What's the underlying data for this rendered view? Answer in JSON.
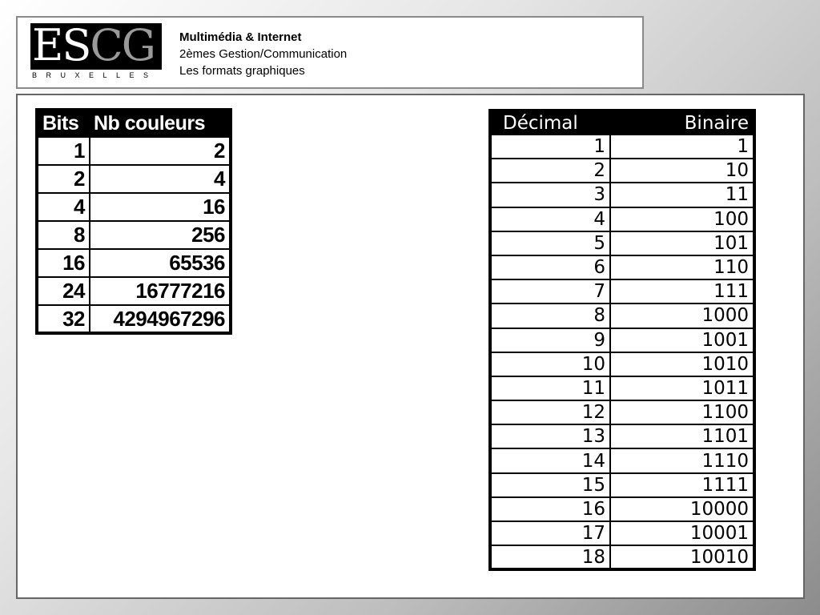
{
  "header": {
    "logo": {
      "letters": [
        "E",
        "S",
        "C",
        "G"
      ],
      "subtitle": "BRUXELLES"
    },
    "title": "Multimédia & Internet",
    "line2": "2èmes Gestion/Communication",
    "line3": "Les formats graphiques"
  },
  "bits_table": {
    "headers": [
      "Bits",
      "Nb couleurs"
    ],
    "rows": [
      [
        "1",
        "2"
      ],
      [
        "2",
        "4"
      ],
      [
        "4",
        "16"
      ],
      [
        "8",
        "256"
      ],
      [
        "16",
        "65536"
      ],
      [
        "24",
        "16777216"
      ],
      [
        "32",
        "4294967296"
      ]
    ]
  },
  "decimal_table": {
    "headers": [
      "Décimal",
      "Binaire"
    ],
    "rows": [
      [
        "1",
        "1"
      ],
      [
        "2",
        "10"
      ],
      [
        "3",
        "11"
      ],
      [
        "4",
        "100"
      ],
      [
        "5",
        "101"
      ],
      [
        "6",
        "110"
      ],
      [
        "7",
        "111"
      ],
      [
        "8",
        "1000"
      ],
      [
        "9",
        "1001"
      ],
      [
        "10",
        "1010"
      ],
      [
        "11",
        "1011"
      ],
      [
        "12",
        "1100"
      ],
      [
        "13",
        "1101"
      ],
      [
        "14",
        "1110"
      ],
      [
        "15",
        "1111"
      ],
      [
        "16",
        "10000"
      ],
      [
        "17",
        "10001"
      ],
      [
        "18",
        "10010"
      ]
    ]
  },
  "colors": {
    "header_bg": "#000000",
    "logo_gray": "#9a9a9a",
    "frame_border": "#8a8a8a"
  }
}
